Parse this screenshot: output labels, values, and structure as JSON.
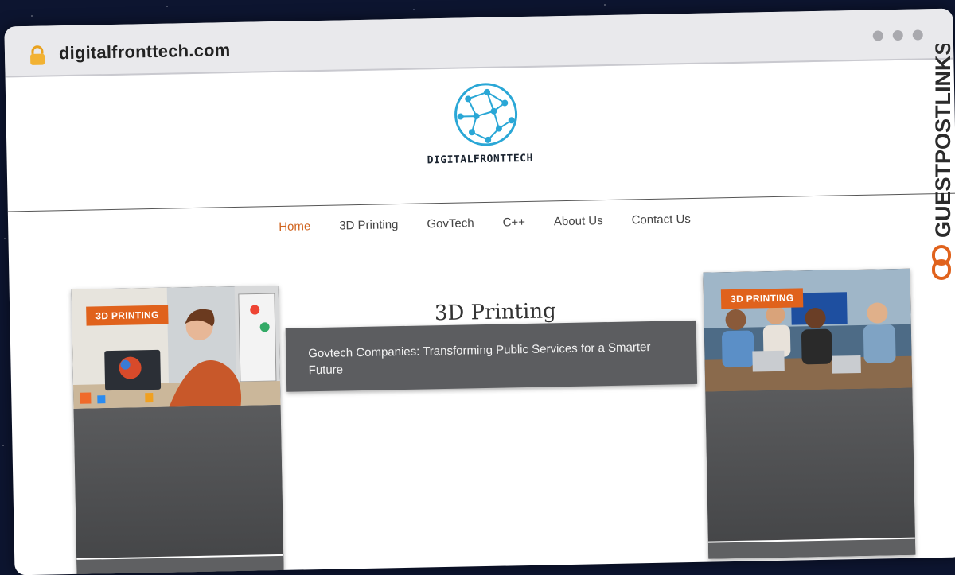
{
  "browser": {
    "url": "digitalfronttech.com"
  },
  "site": {
    "logo_text": "DIGITALFRONTTECH"
  },
  "nav": {
    "items": [
      {
        "label": "Home"
      },
      {
        "label": "3D Printing"
      },
      {
        "label": "GovTech"
      },
      {
        "label": "C++"
      },
      {
        "label": "About Us"
      },
      {
        "label": "Contact Us"
      }
    ]
  },
  "section": {
    "title": "3D Printing"
  },
  "featured": {
    "title": "Govtech Companies: Transforming Public Services for a Smarter Future"
  },
  "cards": [
    {
      "badge": "3D PRINTING"
    },
    {
      "badge": "3D PRINTING"
    }
  ],
  "watermark": {
    "text": "GUESTPOSTLINKS"
  },
  "colors": {
    "accent": "#d0641f",
    "badge": "#e0621c",
    "card": "#4c4d4f"
  }
}
